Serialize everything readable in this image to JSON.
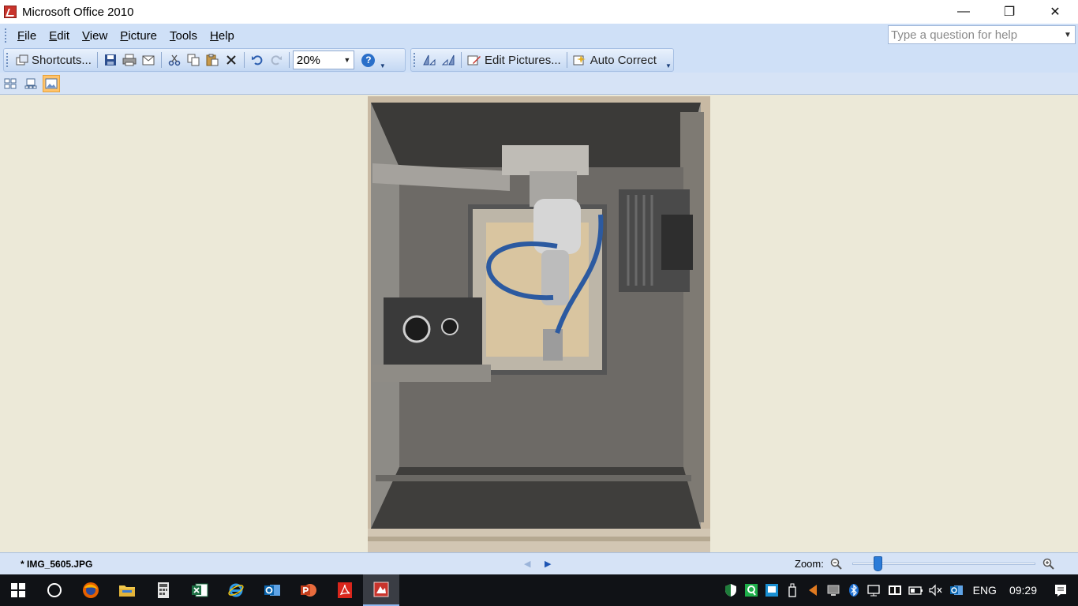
{
  "window": {
    "title": "Microsoft Office 2010",
    "controls": {
      "minimize": "—",
      "maximize": "❐",
      "close": "✕"
    }
  },
  "menu": {
    "items": [
      {
        "key": "F",
        "rest": "ile"
      },
      {
        "key": "E",
        "rest": "dit"
      },
      {
        "key": "V",
        "rest": "iew"
      },
      {
        "key": "P",
        "rest": "icture"
      },
      {
        "key": "T",
        "rest": "ools"
      },
      {
        "key": "H",
        "rest": "elp"
      }
    ],
    "help_placeholder": "Type a question for help"
  },
  "toolbar": {
    "shortcuts_label": "Shortcuts...",
    "zoom_value": "20%",
    "edit_pictures_label": "Edit Pictures...",
    "auto_correct_label": "Auto Correct"
  },
  "status": {
    "filename": "* IMG_5605.JPG",
    "zoom_label": "Zoom:",
    "zoom_level": 0.14
  },
  "taskbar": {
    "apps": [
      "start",
      "cortana",
      "firefox",
      "file-explorer",
      "calculator",
      "excel",
      "internet-explorer",
      "outlook",
      "powerpoint",
      "acrobat",
      "picture-manager"
    ],
    "language": "ENG",
    "time": "09:29"
  },
  "colors": {
    "accent": "#2b7bd8",
    "ribbon": "#cfe0f7",
    "workspace": "#ece9d8"
  }
}
